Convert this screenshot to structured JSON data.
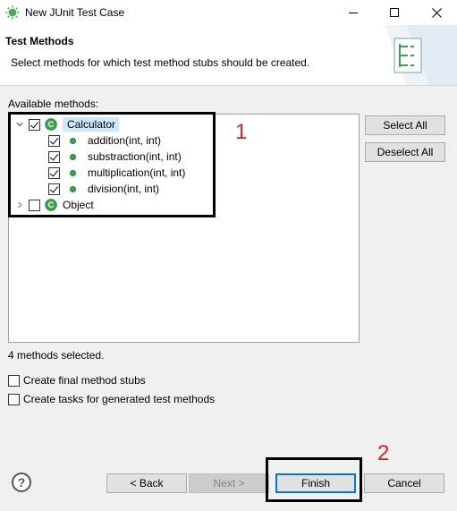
{
  "window": {
    "title": "New JUnit Test Case",
    "icon": "eclipse-sun-icon",
    "controls": {
      "minimize": "minimize-icon",
      "maximize": "maximize-icon",
      "close": "close-icon"
    }
  },
  "header": {
    "title": "Test Methods",
    "description": "Select methods for which test method stubs should be created."
  },
  "methods": {
    "label": "Available methods:",
    "tree": [
      {
        "label": "Calculator",
        "checked": true,
        "expanded": true,
        "selected": true,
        "children": [
          {
            "label": "addition(int, int)",
            "checked": true
          },
          {
            "label": "substraction(int, int)",
            "checked": true
          },
          {
            "label": "multiplication(int, int)",
            "checked": true
          },
          {
            "label": "division(int, int)",
            "checked": true
          }
        ]
      },
      {
        "label": "Object",
        "checked": false,
        "expanded": false,
        "selected": false
      }
    ],
    "select_all": "Select All",
    "deselect_all": "Deselect All",
    "status": "4 methods selected."
  },
  "options": [
    {
      "label": "Create final method stubs",
      "checked": false
    },
    {
      "label": "Create tasks for generated test methods",
      "checked": false
    }
  ],
  "footer": {
    "help": "?",
    "back": "< Back",
    "next": "Next >",
    "finish": "Finish",
    "cancel": "Cancel"
  },
  "annotations": [
    {
      "label": "1"
    },
    {
      "label": "2"
    }
  ],
  "colors": {
    "selection": "#cce8ff",
    "annotation": "#d9261c",
    "accent": "#0078d7",
    "class_icon": "#39a84a"
  }
}
